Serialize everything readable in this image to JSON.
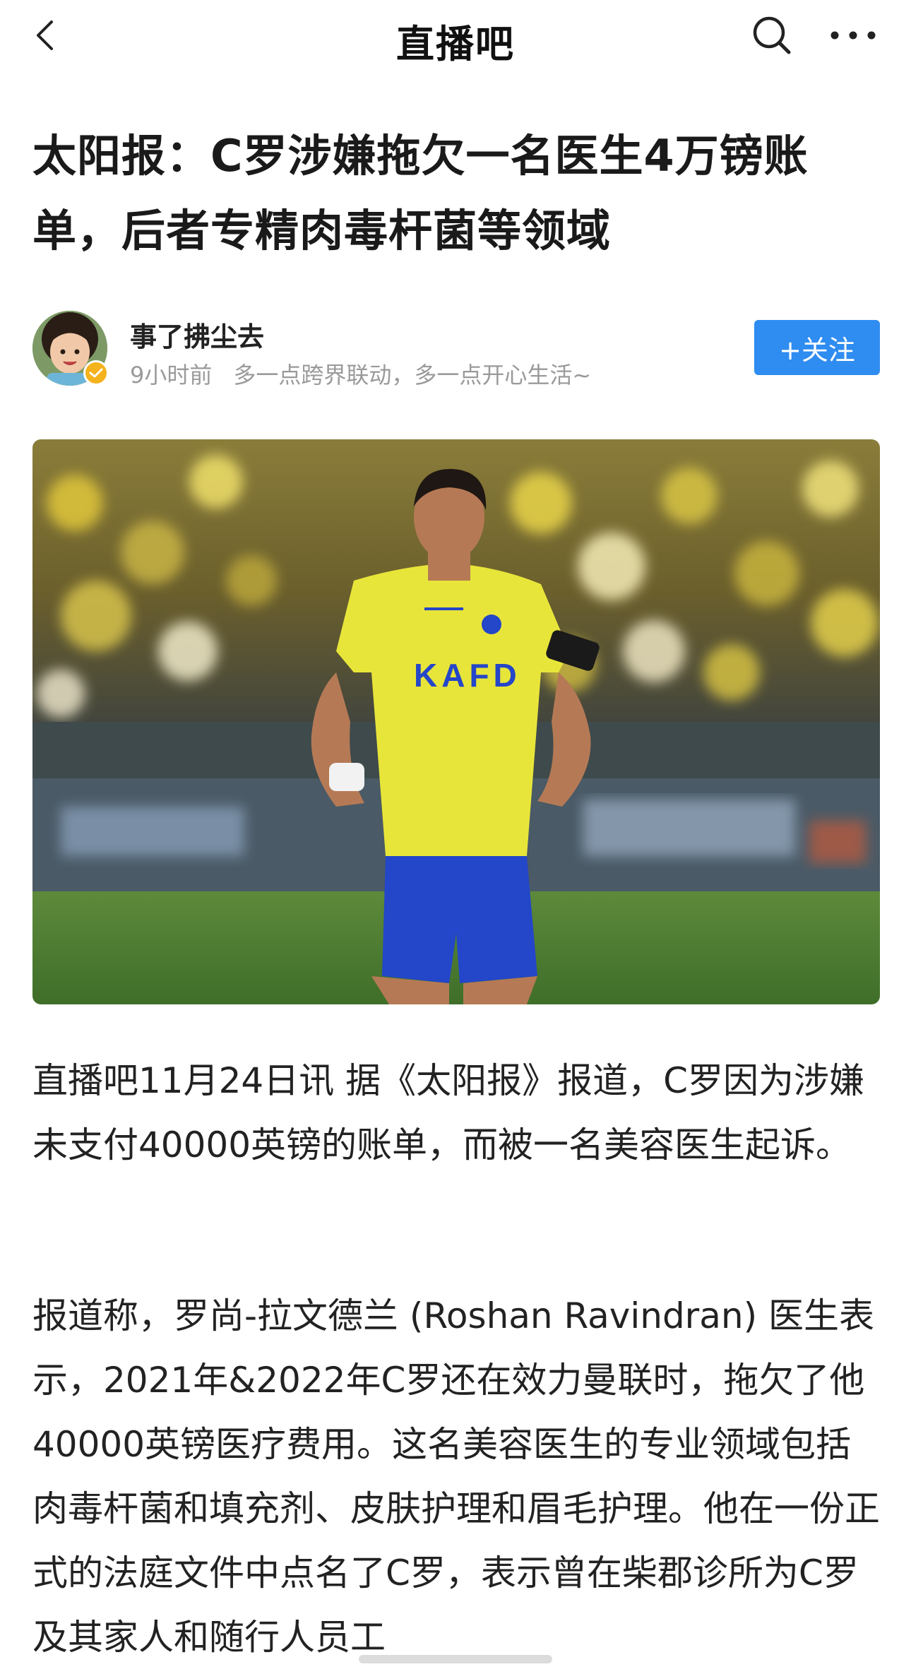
{
  "nav": {
    "title": "直播吧",
    "back_icon": "chevron-left-icon",
    "search_icon": "search-icon",
    "more_icon": "more-horizontal-icon"
  },
  "article": {
    "headline": "太阳报：C罗涉嫌拖欠一名医生4万镑账单，后者专精肉毒杆菌等领域",
    "paragraphs": [
      "直播吧11月24日讯  据《太阳报》报道，C罗因为涉嫌未支付40000英镑的账单，而被一名美容医生起诉。",
      "报道称，罗尚-拉文德兰 (Roshan Ravindran) 医生表示，2021年&2022年C罗还在效力曼联时，拖欠了他40000英镑医疗费用。这名美容医生的专业领域包括肉毒杆菌和填充剂、皮肤护理和眉毛护理。他在一份正式的法庭文件中点名了C罗，表示曾在柴郡诊所为C罗及其家人和随行人员工"
    ]
  },
  "author": {
    "name": "事了拂尘去",
    "time": "9小时前",
    "bio": "多一点跨界联动，多一点开心生活~",
    "follow_label": "+关注",
    "verified_icon": "verified-badge-icon"
  },
  "photo": {
    "jersey_sponsor": "KAFD"
  },
  "colors": {
    "follow_button": "#2f8cf0",
    "meta_text": "#9a9a9a",
    "verified_badge": "#f4b21c",
    "jersey_yellow": "#e8e53a",
    "shorts_blue": "#2446c8"
  }
}
